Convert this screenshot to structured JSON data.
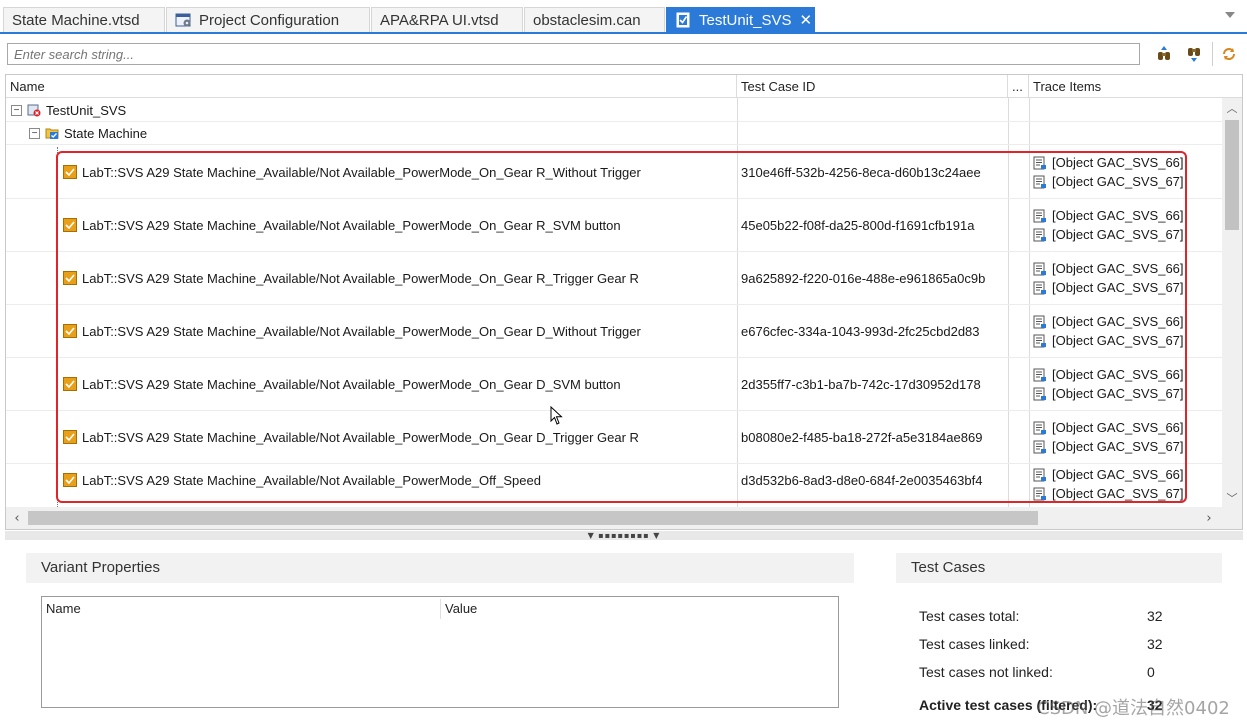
{
  "tabs": [
    {
      "label": "State Machine.vtsd",
      "icon": "none"
    },
    {
      "label": "Project Configuration",
      "icon": "project-config-icon"
    },
    {
      "label": "APA&RPA UI.vtsd",
      "icon": "none"
    },
    {
      "label": "obstaclesim.can",
      "icon": "none"
    },
    {
      "label": "TestUnit_SVS",
      "icon": "test-unit-icon",
      "active": true,
      "close": "✕"
    }
  ],
  "search": {
    "placeholder": "Enter search string..."
  },
  "columns": {
    "name": "Name",
    "test_case_id": "Test Case ID",
    "more": "...",
    "trace_items": "Trace Items"
  },
  "tree": {
    "root": {
      "label": "TestUnit_SVS",
      "expander": "−"
    },
    "group": {
      "label": "State Machine",
      "expander": "−"
    },
    "rows": [
      {
        "name": "LabT::SVS A29 State Machine_Available/Not Available_PowerMode_On_Gear R_Without Trigger",
        "id": "310e46ff-532b-4256-8eca-d60b13c24aee",
        "trace": [
          "[Object GAC_SVS_66]",
          "[Object GAC_SVS_67]"
        ]
      },
      {
        "name": "LabT::SVS A29 State Machine_Available/Not Available_PowerMode_On_Gear R_SVM button",
        "id": "45e05b22-f08f-da25-800d-f1691cfb191a",
        "trace": [
          "[Object GAC_SVS_66]",
          "[Object GAC_SVS_67]"
        ]
      },
      {
        "name": "LabT::SVS A29 State Machine_Available/Not Available_PowerMode_On_Gear R_Trigger Gear R",
        "id": "9a625892-f220-016e-488e-e961865a0c9b",
        "trace": [
          "[Object GAC_SVS_66]",
          "[Object GAC_SVS_67]"
        ]
      },
      {
        "name": "LabT::SVS A29 State Machine_Available/Not Available_PowerMode_On_Gear D_Without Trigger",
        "id": "e676cfec-334a-1043-993d-2fc25cbd2d83",
        "trace": [
          "[Object GAC_SVS_66]",
          "[Object GAC_SVS_67]"
        ]
      },
      {
        "name": "LabT::SVS A29 State Machine_Available/Not Available_PowerMode_On_Gear D_SVM button",
        "id": "2d355ff7-c3b1-ba7b-742c-17d30952d178",
        "trace": [
          "[Object GAC_SVS_66]",
          "[Object GAC_SVS_67]"
        ]
      },
      {
        "name": "LabT::SVS A29 State Machine_Available/Not Available_PowerMode_On_Gear D_Trigger Gear R",
        "id": "b08080e2-f485-ba18-272f-a5e3184ae869",
        "trace": [
          "[Object GAC_SVS_66]",
          "[Object GAC_SVS_67]"
        ]
      },
      {
        "name": "LabT::SVS A29 State Machine_Available/Not Available_PowerMode_Off_Speed",
        "id": "d3d532b6-8ad3-d8e0-684f-2e0035463bf4",
        "trace": [
          "[Object GAC_SVS_66]",
          "[Object GAC_SVS_67]"
        ]
      }
    ]
  },
  "variant_properties": {
    "title": "Variant Properties",
    "col_name": "Name",
    "col_value": "Value"
  },
  "test_cases": {
    "title": "Test Cases",
    "stats": [
      {
        "label": "Test cases total:",
        "value": "32"
      },
      {
        "label": "Test cases linked:",
        "value": "32"
      },
      {
        "label": "Test cases not linked:",
        "value": "0"
      },
      {
        "label": "Active test cases (filtered):",
        "value": "32"
      }
    ]
  },
  "watermark": "CSDN @道法自然0402",
  "colors": {
    "accent": "#2b7ad8",
    "highlight": "#e0252a",
    "testcase_icon": "#e8a019"
  }
}
